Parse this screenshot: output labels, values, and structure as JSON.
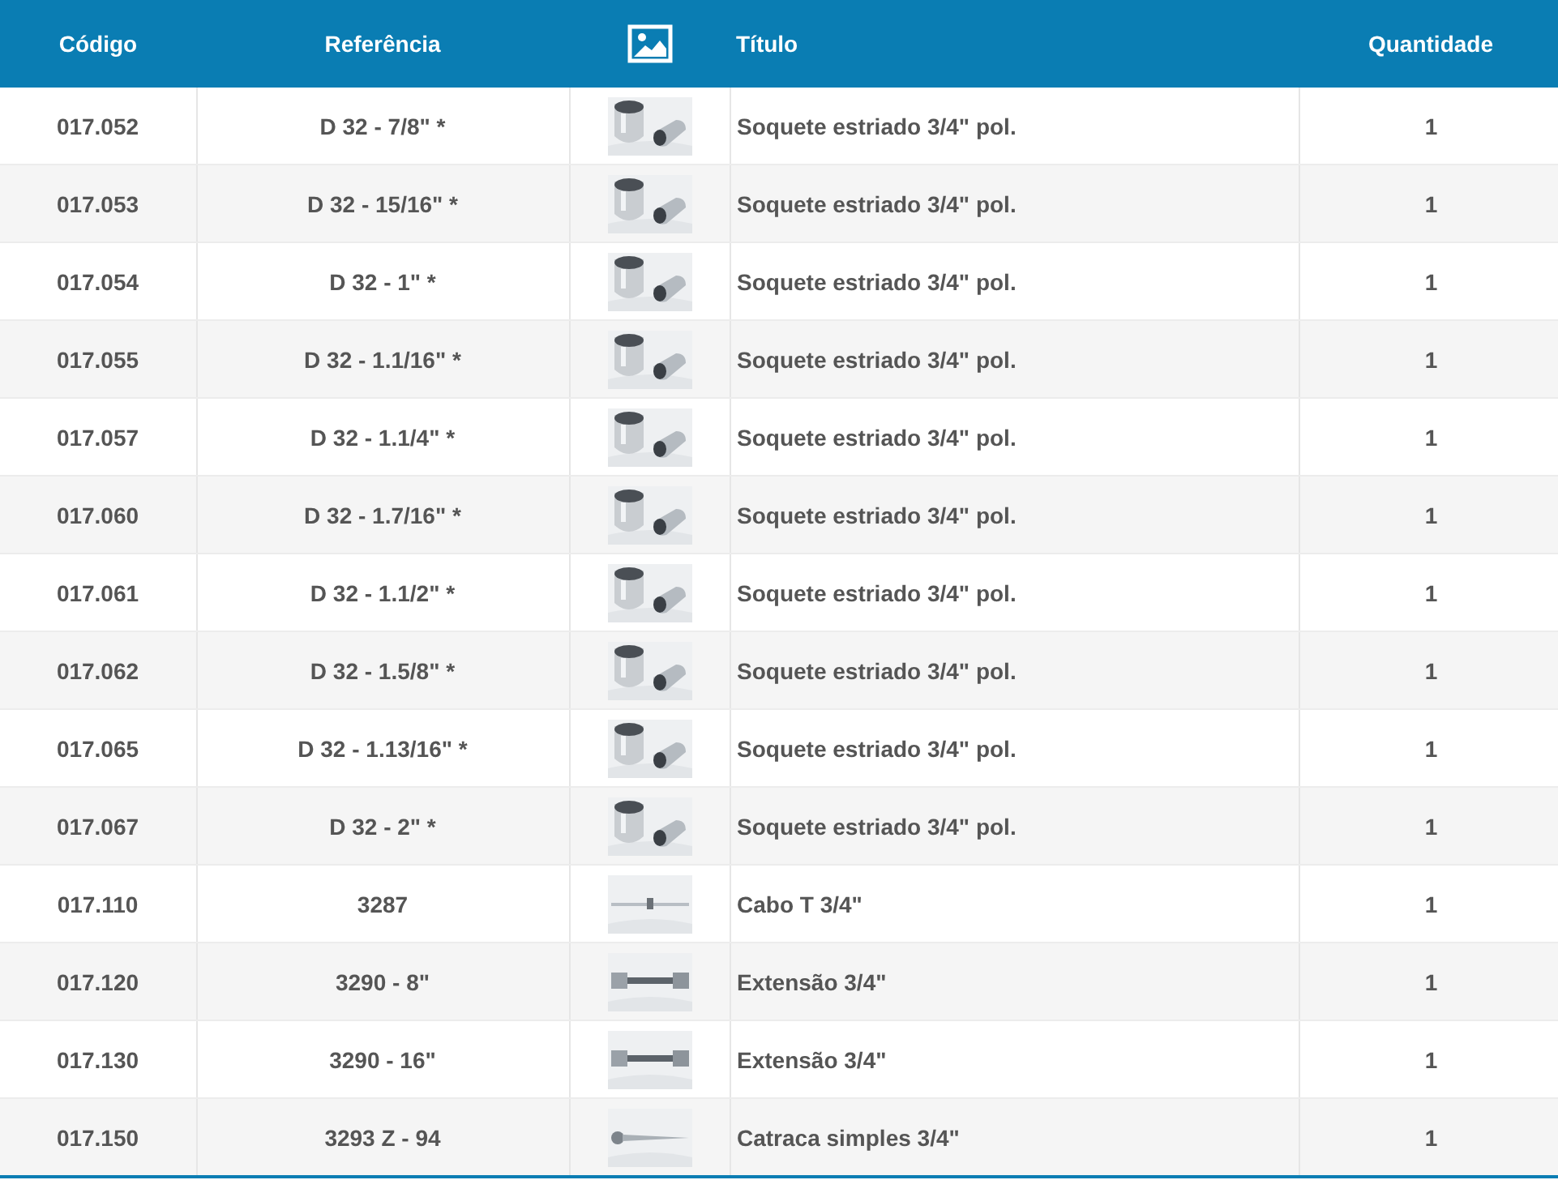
{
  "columns": [
    "Código",
    "Referência",
    "Título",
    "Quantidade"
  ],
  "rows": [
    {
      "code": "017.052",
      "reference": "D 32 - 7/8\" *",
      "kind": "socket",
      "title": "Soquete estriado 3/4\" pol.",
      "quantity": "1"
    },
    {
      "code": "017.053",
      "reference": "D 32 - 15/16\" *",
      "kind": "socket",
      "title": "Soquete estriado 3/4\" pol.",
      "quantity": "1"
    },
    {
      "code": "017.054",
      "reference": "D 32 - 1\" *",
      "kind": "socket",
      "title": "Soquete estriado 3/4\" pol.",
      "quantity": "1"
    },
    {
      "code": "017.055",
      "reference": "D 32 - 1.1/16\" *",
      "kind": "socket",
      "title": "Soquete estriado 3/4\" pol.",
      "quantity": "1"
    },
    {
      "code": "017.057",
      "reference": "D 32 - 1.1/4\" *",
      "kind": "socket",
      "title": "Soquete estriado 3/4\" pol.",
      "quantity": "1"
    },
    {
      "code": "017.060",
      "reference": "D 32 - 1.7/16\" *",
      "kind": "socket",
      "title": "Soquete estriado 3/4\" pol.",
      "quantity": "1"
    },
    {
      "code": "017.061",
      "reference": "D 32 - 1.1/2\" *",
      "kind": "socket",
      "title": "Soquete estriado 3/4\" pol.",
      "quantity": "1"
    },
    {
      "code": "017.062",
      "reference": "D 32 - 1.5/8\" *",
      "kind": "socket",
      "title": "Soquete estriado 3/4\" pol.",
      "quantity": "1"
    },
    {
      "code": "017.065",
      "reference": "D 32 - 1.13/16\" *",
      "kind": "socket",
      "title": "Soquete estriado 3/4\" pol.",
      "quantity": "1"
    },
    {
      "code": "017.067",
      "reference": "D 32 - 2\" *",
      "kind": "socket",
      "title": "Soquete estriado 3/4\" pol.",
      "quantity": "1"
    },
    {
      "code": "017.110",
      "reference": "3287",
      "kind": "handle",
      "title": "Cabo T 3/4\"",
      "quantity": "1"
    },
    {
      "code": "017.120",
      "reference": "3290 - 8\"",
      "kind": "extension",
      "title": "Extensão 3/4\"",
      "quantity": "1"
    },
    {
      "code": "017.130",
      "reference": "3290 - 16\"",
      "kind": "extension",
      "title": "Extensão 3/4\"",
      "quantity": "1"
    },
    {
      "code": "017.150",
      "reference": "3293 Z - 94",
      "kind": "ratchet",
      "title": "Catraca simples 3/4\"",
      "quantity": "1"
    }
  ]
}
